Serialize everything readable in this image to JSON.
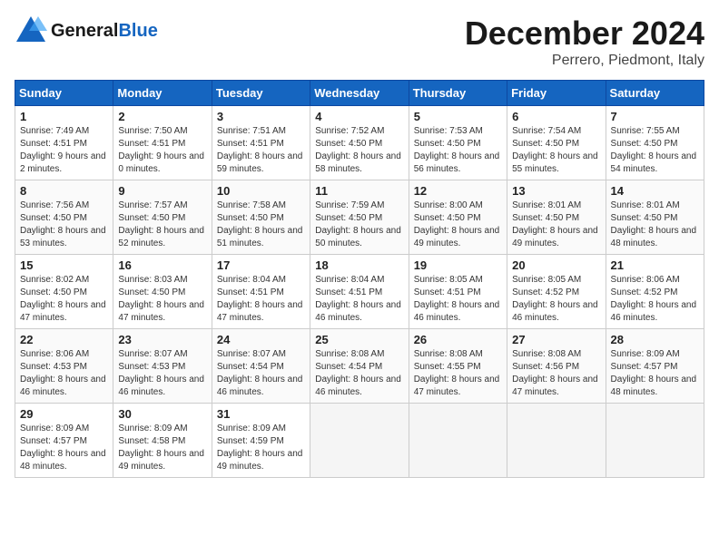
{
  "logo": {
    "general": "General",
    "blue": "Blue",
    "tagline": ""
  },
  "header": {
    "month": "December 2024",
    "location": "Perrero, Piedmont, Italy"
  },
  "weekdays": [
    "Sunday",
    "Monday",
    "Tuesday",
    "Wednesday",
    "Thursday",
    "Friday",
    "Saturday"
  ],
  "weeks": [
    [
      {
        "day": 1,
        "sunrise": "Sunrise: 7:49 AM",
        "sunset": "Sunset: 4:51 PM",
        "daylight": "Daylight: 9 hours and 2 minutes."
      },
      {
        "day": 2,
        "sunrise": "Sunrise: 7:50 AM",
        "sunset": "Sunset: 4:51 PM",
        "daylight": "Daylight: 9 hours and 0 minutes."
      },
      {
        "day": 3,
        "sunrise": "Sunrise: 7:51 AM",
        "sunset": "Sunset: 4:51 PM",
        "daylight": "Daylight: 8 hours and 59 minutes."
      },
      {
        "day": 4,
        "sunrise": "Sunrise: 7:52 AM",
        "sunset": "Sunset: 4:50 PM",
        "daylight": "Daylight: 8 hours and 58 minutes."
      },
      {
        "day": 5,
        "sunrise": "Sunrise: 7:53 AM",
        "sunset": "Sunset: 4:50 PM",
        "daylight": "Daylight: 8 hours and 56 minutes."
      },
      {
        "day": 6,
        "sunrise": "Sunrise: 7:54 AM",
        "sunset": "Sunset: 4:50 PM",
        "daylight": "Daylight: 8 hours and 55 minutes."
      },
      {
        "day": 7,
        "sunrise": "Sunrise: 7:55 AM",
        "sunset": "Sunset: 4:50 PM",
        "daylight": "Daylight: 8 hours and 54 minutes."
      }
    ],
    [
      {
        "day": 8,
        "sunrise": "Sunrise: 7:56 AM",
        "sunset": "Sunset: 4:50 PM",
        "daylight": "Daylight: 8 hours and 53 minutes."
      },
      {
        "day": 9,
        "sunrise": "Sunrise: 7:57 AM",
        "sunset": "Sunset: 4:50 PM",
        "daylight": "Daylight: 8 hours and 52 minutes."
      },
      {
        "day": 10,
        "sunrise": "Sunrise: 7:58 AM",
        "sunset": "Sunset: 4:50 PM",
        "daylight": "Daylight: 8 hours and 51 minutes."
      },
      {
        "day": 11,
        "sunrise": "Sunrise: 7:59 AM",
        "sunset": "Sunset: 4:50 PM",
        "daylight": "Daylight: 8 hours and 50 minutes."
      },
      {
        "day": 12,
        "sunrise": "Sunrise: 8:00 AM",
        "sunset": "Sunset: 4:50 PM",
        "daylight": "Daylight: 8 hours and 49 minutes."
      },
      {
        "day": 13,
        "sunrise": "Sunrise: 8:01 AM",
        "sunset": "Sunset: 4:50 PM",
        "daylight": "Daylight: 8 hours and 49 minutes."
      },
      {
        "day": 14,
        "sunrise": "Sunrise: 8:01 AM",
        "sunset": "Sunset: 4:50 PM",
        "daylight": "Daylight: 8 hours and 48 minutes."
      }
    ],
    [
      {
        "day": 15,
        "sunrise": "Sunrise: 8:02 AM",
        "sunset": "Sunset: 4:50 PM",
        "daylight": "Daylight: 8 hours and 47 minutes."
      },
      {
        "day": 16,
        "sunrise": "Sunrise: 8:03 AM",
        "sunset": "Sunset: 4:50 PM",
        "daylight": "Daylight: 8 hours and 47 minutes."
      },
      {
        "day": 17,
        "sunrise": "Sunrise: 8:04 AM",
        "sunset": "Sunset: 4:51 PM",
        "daylight": "Daylight: 8 hours and 47 minutes."
      },
      {
        "day": 18,
        "sunrise": "Sunrise: 8:04 AM",
        "sunset": "Sunset: 4:51 PM",
        "daylight": "Daylight: 8 hours and 46 minutes."
      },
      {
        "day": 19,
        "sunrise": "Sunrise: 8:05 AM",
        "sunset": "Sunset: 4:51 PM",
        "daylight": "Daylight: 8 hours and 46 minutes."
      },
      {
        "day": 20,
        "sunrise": "Sunrise: 8:05 AM",
        "sunset": "Sunset: 4:52 PM",
        "daylight": "Daylight: 8 hours and 46 minutes."
      },
      {
        "day": 21,
        "sunrise": "Sunrise: 8:06 AM",
        "sunset": "Sunset: 4:52 PM",
        "daylight": "Daylight: 8 hours and 46 minutes."
      }
    ],
    [
      {
        "day": 22,
        "sunrise": "Sunrise: 8:06 AM",
        "sunset": "Sunset: 4:53 PM",
        "daylight": "Daylight: 8 hours and 46 minutes."
      },
      {
        "day": 23,
        "sunrise": "Sunrise: 8:07 AM",
        "sunset": "Sunset: 4:53 PM",
        "daylight": "Daylight: 8 hours and 46 minutes."
      },
      {
        "day": 24,
        "sunrise": "Sunrise: 8:07 AM",
        "sunset": "Sunset: 4:54 PM",
        "daylight": "Daylight: 8 hours and 46 minutes."
      },
      {
        "day": 25,
        "sunrise": "Sunrise: 8:08 AM",
        "sunset": "Sunset: 4:54 PM",
        "daylight": "Daylight: 8 hours and 46 minutes."
      },
      {
        "day": 26,
        "sunrise": "Sunrise: 8:08 AM",
        "sunset": "Sunset: 4:55 PM",
        "daylight": "Daylight: 8 hours and 47 minutes."
      },
      {
        "day": 27,
        "sunrise": "Sunrise: 8:08 AM",
        "sunset": "Sunset: 4:56 PM",
        "daylight": "Daylight: 8 hours and 47 minutes."
      },
      {
        "day": 28,
        "sunrise": "Sunrise: 8:09 AM",
        "sunset": "Sunset: 4:57 PM",
        "daylight": "Daylight: 8 hours and 48 minutes."
      }
    ],
    [
      {
        "day": 29,
        "sunrise": "Sunrise: 8:09 AM",
        "sunset": "Sunset: 4:57 PM",
        "daylight": "Daylight: 8 hours and 48 minutes."
      },
      {
        "day": 30,
        "sunrise": "Sunrise: 8:09 AM",
        "sunset": "Sunset: 4:58 PM",
        "daylight": "Daylight: 8 hours and 49 minutes."
      },
      {
        "day": 31,
        "sunrise": "Sunrise: 8:09 AM",
        "sunset": "Sunset: 4:59 PM",
        "daylight": "Daylight: 8 hours and 49 minutes."
      },
      null,
      null,
      null,
      null
    ]
  ]
}
